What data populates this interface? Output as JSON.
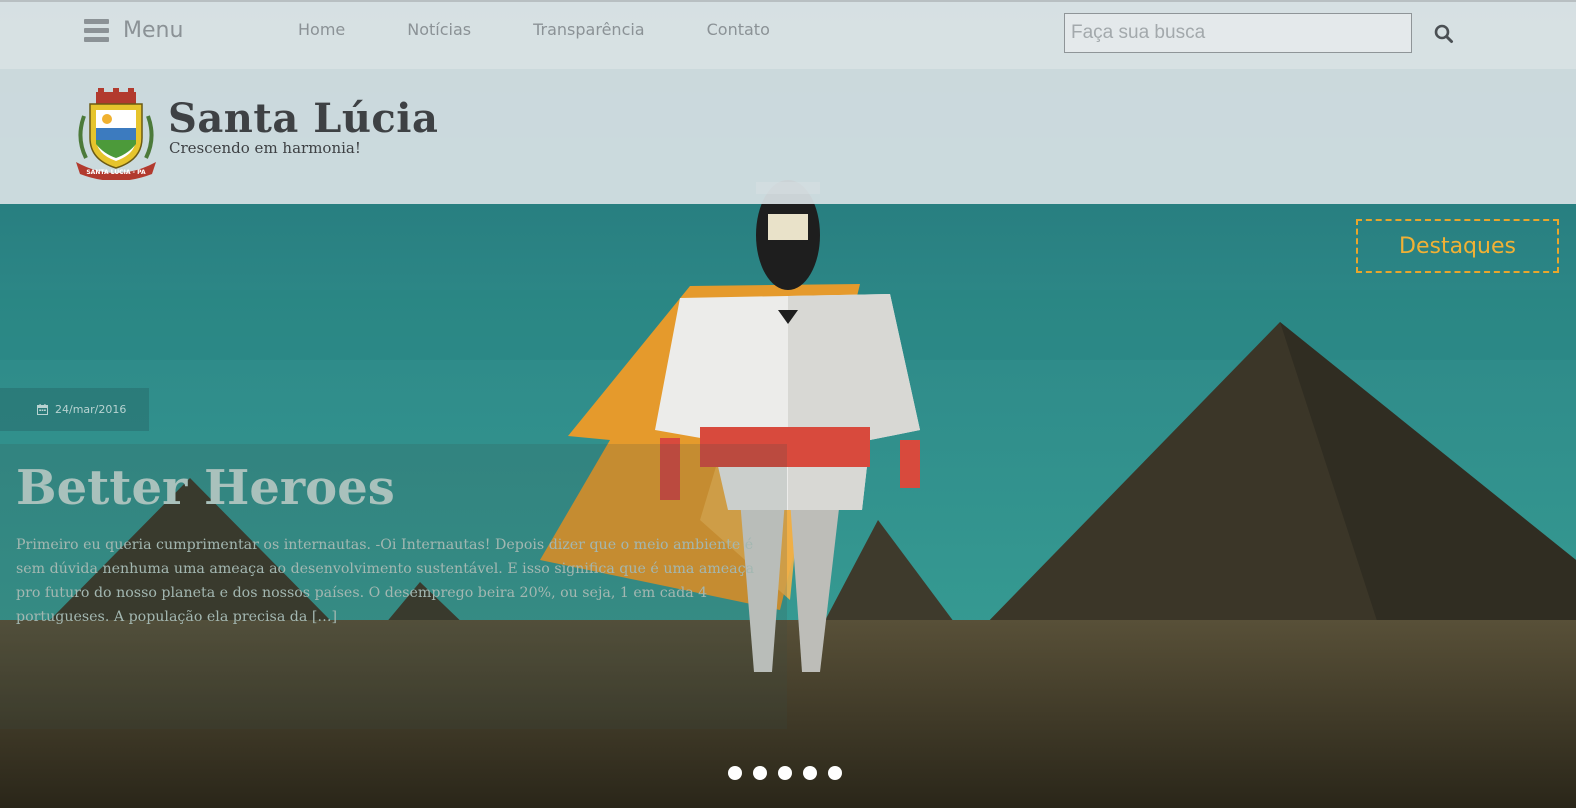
{
  "header": {
    "menu_label": "Menu",
    "nav": [
      {
        "label": "Home"
      },
      {
        "label": "Notícias"
      },
      {
        "label": "Transparência"
      },
      {
        "label": "Contato"
      }
    ],
    "search": {
      "placeholder": "Faça sua busca",
      "value": ""
    }
  },
  "brand": {
    "title": "Santa Lúcia",
    "tagline": "Crescendo em harmonia!",
    "crest_ribbon_text": "SANTA LUCIA - PA"
  },
  "highlights_label": "Destaques",
  "slider": {
    "date": "24/mar/2016",
    "title": "Better Heroes",
    "excerpt": "Primeiro eu queria cumprimentar os internautas. -Oi Internautas! Depois dizer que o meio ambiente é sem dúvida nenhuma uma ameaça ao desenvolvimento sustentável. E isso significa que é uma ameaça pro futuro do nosso planeta e dos nossos países. O desemprego beira 20%, ou seja, 1 em cada 4 portugueses. A população ela precisa da […]",
    "slide_count": 5
  },
  "colors": {
    "accent": "#f2b134",
    "sky": "#2f8a89",
    "ground": "#4a4433",
    "nav_text": "#8b9296",
    "title_text": "#3e4144"
  },
  "icons": {
    "menu": "hamburger-icon",
    "search": "search-icon",
    "date": "calendar-icon"
  }
}
